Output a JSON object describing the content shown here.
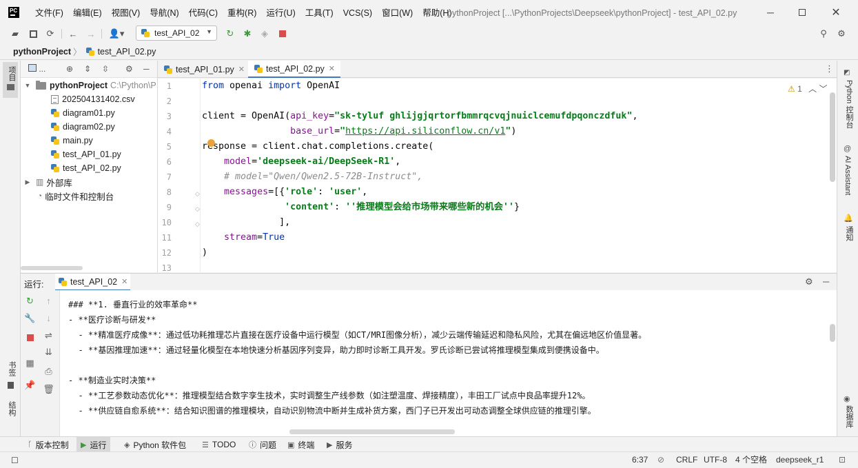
{
  "app": {
    "logo_text": "PC",
    "window_title": "pythonProject [...\\PythonProjects\\Deepseek\\pythonProject] - test_API_02.py"
  },
  "menu": [
    "文件(F)",
    "编辑(E)",
    "视图(V)",
    "导航(N)",
    "代码(C)",
    "重构(R)",
    "运行(U)",
    "工具(T)",
    "VCS(S)",
    "窗口(W)",
    "帮助(H)"
  ],
  "toolbar": {
    "run_config": "test_API_02"
  },
  "navbar": {
    "project": "pythonProject",
    "file": "test_API_02.py"
  },
  "left_stripe": {
    "project_label": "项目",
    "bookmarks_label": "书签",
    "structure_label": "结构"
  },
  "project_panel": {
    "root_name": "pythonProject",
    "root_path": "C:\\Python\\P",
    "files": [
      "202504131402.csv",
      "diagram01.py",
      "diagram02.py",
      "main.py",
      "test_API_01.py",
      "test_API_02.py"
    ],
    "external_libs": "外部库",
    "scratches": "临时文件和控制台"
  },
  "editor": {
    "tabs": [
      "test_API_01.py",
      "test_API_02.py"
    ],
    "warning_count": "1",
    "line_numbers": [
      "1",
      "2",
      "3",
      "4",
      "5",
      "6",
      "7",
      "8",
      "9",
      "10",
      "11",
      "12",
      "13"
    ],
    "code": {
      "l1_kw1": "from",
      "l1_mod": " openai ",
      "l1_kw2": "import",
      "l1_cls": " OpenAI",
      "l3_a": "client = OpenAI(",
      "l3_p": "api_key",
      "l3_eq": "=",
      "l3_s": "\"sk-tyluf ghlijgjqrtorfbmmrqcvqjnuiclcemufdpqonczdfuk\"",
      "l3_c": ",",
      "l4_ind": "                ",
      "l4_p": "base_url",
      "l4_eq": "=",
      "l4_q1": "\"",
      "l4_url": "https://api.siliconflow.cn/v1",
      "l4_q2": "\"",
      "l4_end": ")",
      "l5": "response = client.chat.completions.create(",
      "l6_ind": "    ",
      "l6_p": "model",
      "l6_eq": "=",
      "l6_s": "'deepseek-ai/DeepSeek-R1'",
      "l6_c": ",",
      "l7_ind": "    ",
      "l7_cmt": "# model=\"Qwen/Qwen2.5-72B-Instruct\",",
      "l8_ind": "    ",
      "l8_p": "messages",
      "l8_a": "=[{",
      "l8_s1": "'role'",
      "l8_b": ": ",
      "l8_s2": "'user'",
      "l8_c": ",",
      "l9_ind": "               ",
      "l9_s1": "'content'",
      "l9_b": ": ",
      "l9_s2": "''推理模型会给市场带来哪些新的机会''",
      "l9_c": "}",
      "l10": "              ],",
      "l11_ind": "    ",
      "l11_p": "stream",
      "l11_eq": "=",
      "l11_kw": "True",
      "l12": ")"
    }
  },
  "right_stripe": {
    "python_console": "Python 控制台",
    "ai_assistant": "AI Assistant",
    "notifications": "通知",
    "database": "数据库"
  },
  "run_panel": {
    "label": "运行:",
    "tab": "test_API_02",
    "lines": [
      "### **1. 垂直行业的效率革命**",
      "- **医疗诊断与研发**",
      "  - **精准医疗成像**：通过低功耗推理芯片直接在医疗设备中运行模型（如CT/MRI图像分析），减少云端传输延迟和隐私风险，尤其在偏远地区价值显著。",
      "  - **基因推理加速**：通过轻量化模型在本地快速分析基因序列变异，助力即时诊断工具开发。罗氏诊断已尝试将推理模型集成到便携设备中。",
      "",
      "- **制造业实时决策**",
      "  - **工艺参数动态优化**：推理模型结合数字孪生技术，实时调整生产线参数（如注塑温度、焊接精度），丰田工厂试点中良品率提升12%。",
      "  - **供应链自愈系统**：结合知识图谱的推理模块，自动识别物流中断并生成补货方案，西门子已开发出可动态调整全球供应链的推理引擎。"
    ]
  },
  "tool_windows": [
    "版本控制",
    "运行",
    "Python 软件包",
    "TODO",
    "问题",
    "终端",
    "服务"
  ],
  "status": {
    "position": "6:37",
    "line_sep": "CRLF",
    "encoding": "UTF-8",
    "indent": "4 个空格",
    "interpreter": "deepseek_r1"
  }
}
